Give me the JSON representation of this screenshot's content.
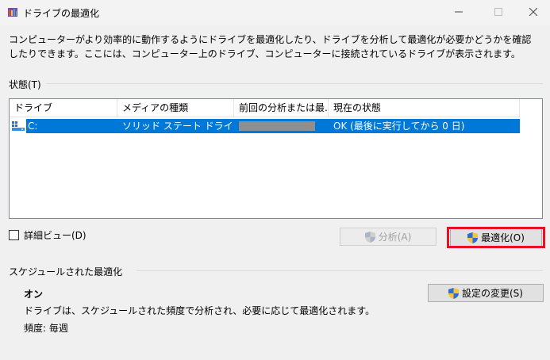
{
  "window": {
    "title": "ドライブの最適化",
    "controls": {
      "minimize": "minimize",
      "maximize": "maximize",
      "close": "close"
    }
  },
  "description": "コンピューターがより効率的に動作するようにドライブを最適化したり、ドライブを分析して最適化が必要かどうかを確認したりできます。ここには、コンピューター上のドライブ、コンピューターに接続されているドライブが表示されます。",
  "status_group": {
    "label": "状態(T)",
    "columns": [
      "ドライブ",
      "メディアの種類",
      "前回の分析または最...",
      "現在の状態"
    ],
    "rows": [
      {
        "drive": "C:",
        "media_type": "ソリッド ステート ドライブ",
        "last_run": "",
        "current_status": "OK (最後に実行してから 0 日)",
        "selected": true
      }
    ]
  },
  "details_checkbox": {
    "label": "詳細ビュー(D)",
    "checked": false
  },
  "buttons": {
    "analyze": "分析(A)",
    "optimize": "最適化(O)",
    "change_settings": "設定の変更(S)"
  },
  "schedule_group": {
    "label": "スケジュールされた最適化",
    "status": "オン",
    "description": "ドライブは、スケジュールされた頻度で分析され、必要に応じて最適化されます。",
    "frequency": "頻度: 毎週"
  },
  "colors": {
    "selection": "#0078d7",
    "highlight": "#e81123",
    "background": "#f0f0f0"
  },
  "icons": {
    "app": "defrag-app-icon",
    "drive": "drive-icon",
    "shield": "uac-shield-icon"
  }
}
